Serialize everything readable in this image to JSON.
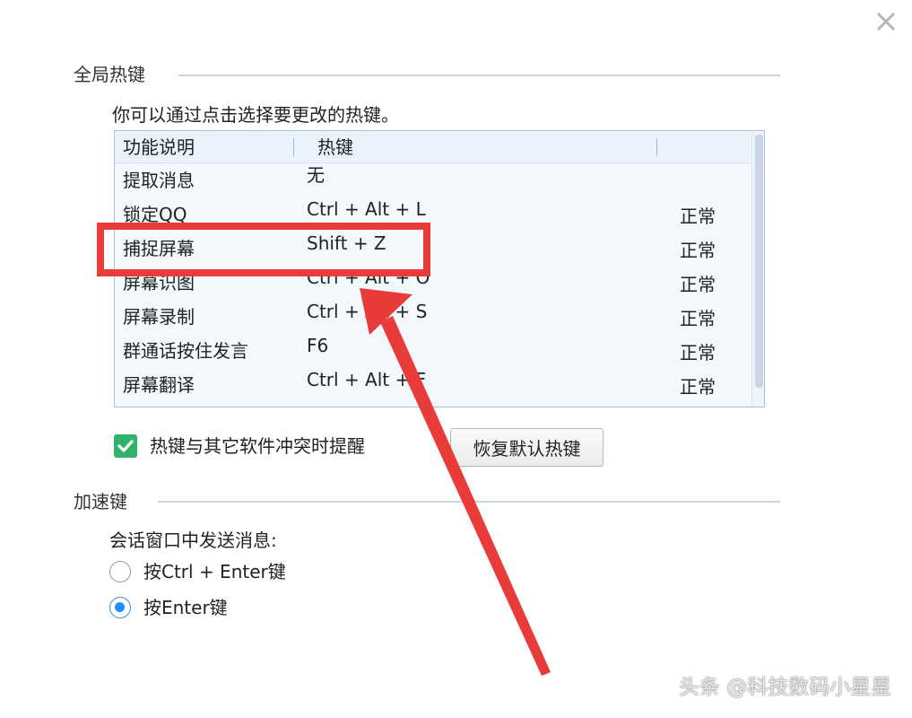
{
  "window": {
    "close_icon": "close-icon"
  },
  "global_hotkeys": {
    "title": "全局热键",
    "hint": "你可以通过点击选择要更改的热键。",
    "columns": [
      "功能说明",
      "热键",
      ""
    ],
    "rows": [
      {
        "func": "提取消息",
        "key": "无",
        "status": ""
      },
      {
        "func": "锁定QQ",
        "key": "Ctrl + Alt + L",
        "status": "正常"
      },
      {
        "func": "捕捉屏幕",
        "key": "Shift + Z",
        "status": "正常"
      },
      {
        "func": "屏幕识图",
        "key": "Ctrl + Alt + O",
        "status": "正常"
      },
      {
        "func": "屏幕录制",
        "key": "Ctrl + Alt + S",
        "status": "正常"
      },
      {
        "func": "群通话按住发言",
        "key": "F6",
        "status": "正常"
      },
      {
        "func": "屏幕翻译",
        "key": "Ctrl + Alt + F",
        "status": "正常"
      }
    ],
    "conflict_checkbox": {
      "label": "热键与其它软件冲突时提醒",
      "checked": true
    },
    "reset_button": "恢复默认热键"
  },
  "accelerator": {
    "title": "加速键",
    "sub_label": "会话窗口中发送消息:",
    "options": [
      {
        "label": "按Ctrl + Enter键",
        "selected": false
      },
      {
        "label": "按Enter键",
        "selected": true
      }
    ]
  },
  "annotation": {
    "highlight_color": "#ea3b3b"
  },
  "watermark": "头条 @科技数码小星星",
  "colors": {
    "accent_green": "#2fb36b",
    "radio_blue": "#1e90ff",
    "table_bg": "#f3f8fd",
    "table_border": "#a9c3de"
  }
}
